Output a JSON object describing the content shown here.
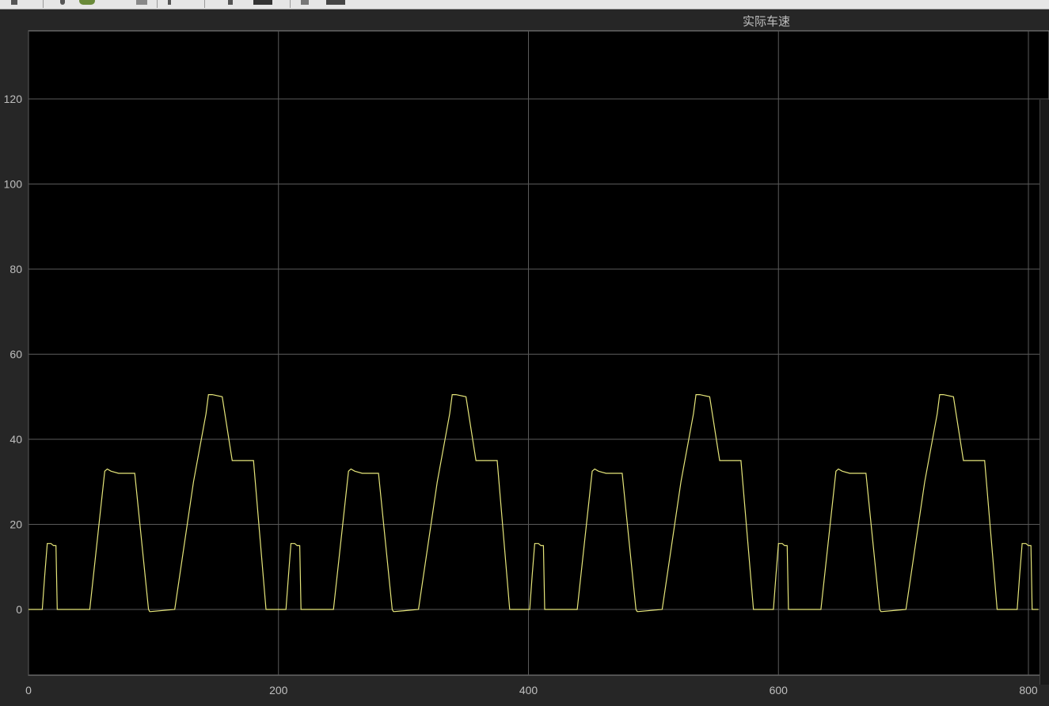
{
  "toolbar": {
    "icons": [
      "run-icon",
      "record-icon",
      "step-icon",
      "print-icon",
      "cursor-icon",
      "zoom-icon",
      "layout-icon",
      "settings-icon"
    ]
  },
  "colors": {
    "background": "#000000",
    "frame": "#262626",
    "grid": "#5a5a5a",
    "axis_text": "#bfbfbf",
    "line": "#e6e67a"
  },
  "chart_data": {
    "type": "line",
    "title": "实际车速",
    "xlabel": "",
    "ylabel": "",
    "xlim": [
      0,
      810
    ],
    "ylim": [
      -15,
      135
    ],
    "xticks": [
      0,
      200,
      400,
      600,
      800
    ],
    "yticks": [
      0,
      20,
      40,
      60,
      80,
      100,
      120
    ],
    "grid": true,
    "series": [
      {
        "cycle_period": 195,
        "num_cycles_shown": 4.2,
        "x": [
          0,
          11,
          13,
          15,
          18,
          20,
          22,
          23,
          28,
          49,
          61,
          63,
          66,
          72,
          85,
          96,
          97,
          98,
          117,
          132,
          142,
          144,
          147,
          155,
          163,
          166,
          180,
          190,
          195
        ],
        "values": [
          0,
          0,
          8,
          15.5,
          15.5,
          15,
          15,
          0,
          0,
          0,
          32.5,
          33,
          32.5,
          32,
          32,
          0,
          -0.5,
          -0.5,
          0,
          30,
          46,
          50.5,
          50.5,
          50,
          35,
          35,
          35,
          0,
          0
        ]
      }
    ]
  }
}
